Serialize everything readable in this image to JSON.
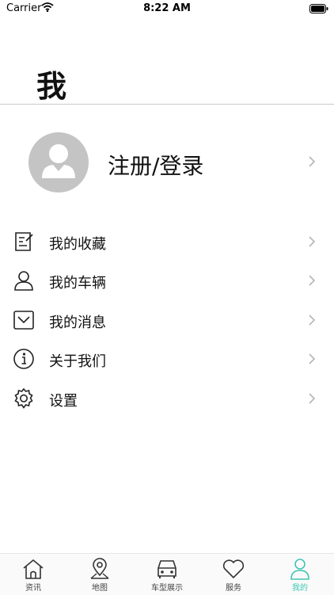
{
  "status_bar": {
    "carrier": "Carrier",
    "time": "8:22 AM",
    "wifi_icon": "wifi-icon",
    "battery_icon": "battery-icon"
  },
  "header": {
    "title": "我"
  },
  "profile": {
    "avatar_icon": "avatar-placeholder-icon",
    "login_label": "注册/登录"
  },
  "menu": {
    "items": [
      {
        "label": "我的收藏",
        "icon": "note-edit-icon"
      },
      {
        "label": "我的车辆",
        "icon": "user-icon"
      },
      {
        "label": "我的消息",
        "icon": "mail-icon"
      },
      {
        "label": "关于我们",
        "icon": "info-icon"
      },
      {
        "label": "设置",
        "icon": "gear-icon"
      }
    ]
  },
  "tab_bar": {
    "accent_color": "#3fc6b3",
    "active_tab": "我的",
    "tabs": [
      {
        "label": "资讯",
        "icon": "home-icon"
      },
      {
        "label": "地图",
        "icon": "map-pin-icon"
      },
      {
        "label": "车型展示",
        "icon": "car-icon"
      },
      {
        "label": "服务",
        "icon": "heart-icon"
      },
      {
        "label": "我的",
        "icon": "user-icon"
      }
    ]
  }
}
